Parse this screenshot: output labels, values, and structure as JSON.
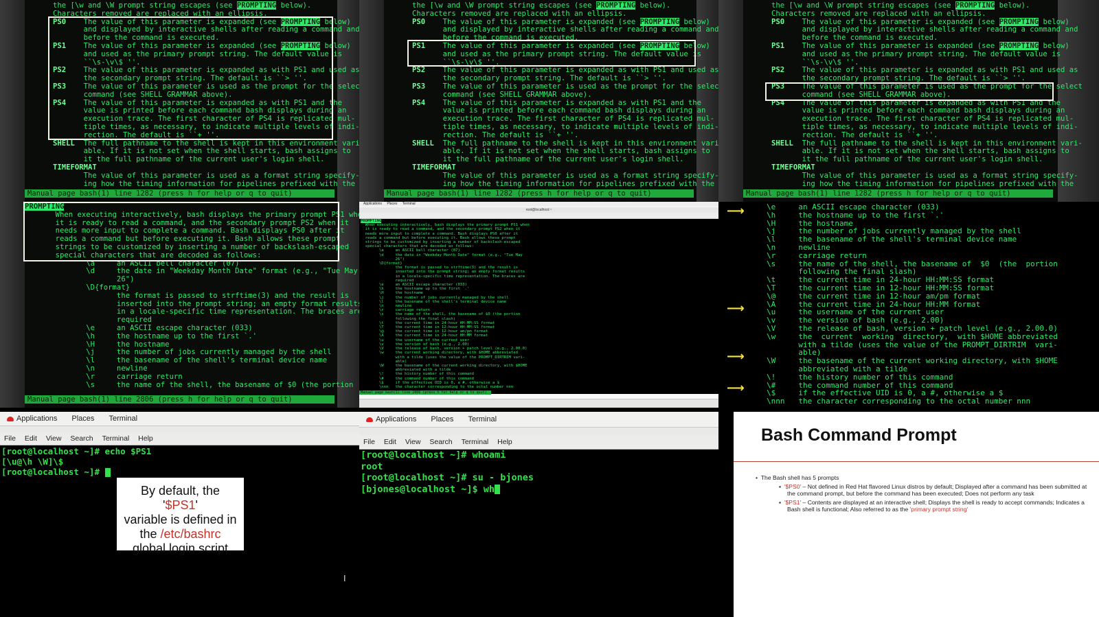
{
  "panel1": {
    "lines": [
      "the [\\w and \\W prompt string escapes (see PROMPTING below).",
      "Characters removed are replaced with an ellipsis.",
      "PS0    The value of this parameter is expanded (see PROMPTING below)",
      "       and displayed by interactive shells after reading a command and",
      "       before the command is executed.",
      "PS1    The value of this parameter is expanded (see PROMPTING below)",
      "       and used as the primary prompt string. The default value is",
      "       ``\\s-\\v\\$ ''.",
      "PS2    The value of this parameter is expanded as with PS1 and used as",
      "       the secondary prompt string. The default is ``> ''.",
      "PS3    The value of this parameter is used as the prompt for the select",
      "       command (see SHELL GRAMMAR above).",
      "PS4    The value of this parameter is expanded as with PS1 and the",
      "       value is printed before each command bash displays during an",
      "       execution trace. The first character of PS4 is replicated mul-",
      "       tiple times, as necessary, to indicate multiple levels of indi-",
      "       rection. The default is ``+ ''.",
      "SHELL  The full pathname to the shell is kept in this environment vari-",
      "       able. If it is not set when the shell starts, bash assigns to",
      "       it the full pathname of the current user's login shell.",
      "TIMEFORMAT",
      "       The value of this parameter is used as a format string specify-",
      "       ing how the timing information for pipelines prefixed with the"
    ],
    "status": "Manual page bash(1) line 1282 (press h for help or q to quit)"
  },
  "panel4": {
    "lines": [
      "PROMPTING",
      "       When executing interactively, bash displays the primary prompt PS1 when",
      "       it is ready to read a command, and the secondary prompt PS2 when it",
      "       needs more input to complete a command. Bash displays PS0 after it",
      "       reads a command but before executing it. Bash allows these prompt",
      "       strings to be customized by inserting a number of backslash-escaped",
      "       special characters that are decoded as follows:",
      "              \\a     an ASCII bell character (07)",
      "              \\d     the date in \"Weekday Month Date\" format (e.g., \"Tue May",
      "                     26\")",
      "              \\D{format}",
      "                     the format is passed to strftime(3) and the result is",
      "                     inserted into the prompt string; an empty format results",
      "                     in a locale-specific time representation. The braces are",
      "                     required",
      "              \\e     an ASCII escape character (033)",
      "              \\h     the hostname up to the first `.'",
      "              \\H     the hostname",
      "              \\j     the number of jobs currently managed by the shell",
      "              \\l     the basename of the shell's terminal device name",
      "              \\n     newline",
      "              \\r     carriage return",
      "              \\s     the name of the shell, the basename of $0 (the portion"
    ],
    "status": "Manual page bash(1) line 2806 (press h for help or q to quit)"
  },
  "panel5": {
    "topbar": [
      "Applications",
      "Places",
      "Terminal"
    ],
    "window_title": "root@localhost:~",
    "lines": [
      "PROMPTING",
      "  When executing interactively, bash displays the primary prompt PS1 when",
      "  it is ready to read a command, and the secondary prompt PS2 when it",
      "  needs more input to complete a command. Bash displays PS0 after it",
      "  reads a command but before executing it. Bash allows these prompt",
      "  strings to be customized by inserting a number of backslash-escaped",
      "  special characters that are decoded as follows:",
      "        \\a     an ASCII bell character (07)",
      "        \\d     the date in \"Weekday Month Date\" format (e.g., \"Tue May",
      "               26\")",
      "        \\D{format}",
      "               the format is passed to strftime(3) and the result is",
      "               inserted into the prompt string; an empty format results",
      "               in a locale-specific time representation. The braces are",
      "               required",
      "        \\e     an ASCII escape character (033)",
      "        \\h     the hostname up to the first `.'",
      "        \\H     the hostname",
      "        \\j     the number of jobs currently managed by the shell",
      "        \\l     the basename of the shell's terminal device name",
      "        \\n     newline",
      "        \\r     carriage return",
      "        \\s     the name of the shell, the basename of $0 (the portion",
      "               following the final slash)",
      "        \\t     the current time in 24-hour HH:MM:SS format",
      "        \\T     the current time in 12-hour HH:MM:SS format",
      "        \\@     the current time in 12-hour am/pm format",
      "        \\A     the current time in 24-hour HH:MM format",
      "        \\u     the username of the current user",
      "        \\v     the version of bash (e.g., 2.00)",
      "        \\V     the release of bash, version + patch level (e.g., 2.00.0)",
      "        \\w     the current working directory, with $HOME abbreviated",
      "               with a tilde (uses the value of the PROMPT_DIRTRIM vari-",
      "               able)",
      "        \\W     the basename of the current working directory, with $HOME",
      "               abbreviated with a tilde",
      "        \\!     the history number of this command",
      "        \\#     the command number of this command",
      "        \\$     if the effective UID is 0, a #, otherwise a $",
      "        \\nnn   the character corresponding to the octal number nnn"
    ],
    "status": "Manual page bash(1) line 2806 (press h for help or q to quit)"
  },
  "panel6": {
    "lines": [
      "\\e     an ASCII escape character (033)",
      "\\h     the hostname up to the first `.'",
      "\\H     the hostname",
      "\\j     the number of jobs currently managed by the shell",
      "\\l     the basename of the shell's terminal device name",
      "\\n     newline",
      "\\r     carriage return",
      "\\s     the name of the shell, the basename of  $0  (the  portion",
      "       following the final slash)",
      "\\t     the current time in 24-hour HH:MM:SS format",
      "\\T     the current time in 12-hour HH:MM:SS format",
      "\\@     the current time in 12-hour am/pm format",
      "\\A     the current time in 24-hour HH:MM format",
      "\\u     the username of the current user",
      "\\v     the version of bash (e.g., 2.00)",
      "\\V     the release of bash, version + patch level (e.g., 2.00.0)",
      "\\w     the  current  working  directory,  with $HOME abbreviated",
      "       with a tilde (uses the value of the PROMPT_DIRTRIM  vari-",
      "       able)",
      "\\W     the basename of the current working directory, with $HOME",
      "       abbreviated with a tilde",
      "\\!     the history number of this command",
      "\\#     the command number of this command",
      "\\$     if the effective UID is 0, a #, otherwise a $",
      "\\nnn   the character corresponding to the octal number nnn"
    ],
    "arrow_glyph": "⟶"
  },
  "panel7": {
    "topbar": [
      "Applications",
      "Places",
      "Terminal"
    ],
    "menu": [
      "File",
      "Edit",
      "View",
      "Search",
      "Terminal",
      "Help"
    ],
    "lines": [
      "[root@localhost ~]# echo $PS1",
      "[\\u@\\h \\W]\\$",
      "[root@localhost ~]# "
    ],
    "callout": {
      "line1_pre": "By default, the '",
      "line1_var": "$PS1",
      "line1_post": "'",
      "line2": "variable is defined in",
      "line3_pre": "the ",
      "line3_path": "/etc/bashrc",
      "line4": "global login script"
    }
  },
  "panel8": {
    "topbar": [
      "Applications",
      "Places",
      "Terminal"
    ],
    "menu": [
      "File",
      "Edit",
      "View",
      "Search",
      "Terminal",
      "Help"
    ],
    "lines": [
      "[root@localhost ~]# whoami",
      "root",
      "[root@localhost ~]# su - bjones",
      "[bjones@localhost ~]$ wh"
    ]
  },
  "slide": {
    "title": "Bash Command Prompt",
    "bullet": "The Bash shell has 5 prompts",
    "sub": [
      {
        "quoted": "'$PS0'",
        "text": " – Not defined in Red Hat flavored Linux distros by default; Displayed after a command has been submitted at the command prompt, but before the command has been executed; Does not perform any task"
      },
      {
        "quoted": "'$PS1'",
        "text": " – Contents are displayed at an interactive shell; Displays the shell is ready to accept commands; Indicates a Bash shell is functional; Also referred to as the ",
        "tail": "'primary prompt string'"
      }
    ]
  },
  "colors": {
    "terminal_green": "#2ee86a",
    "highlight_box": "#f6f6e8",
    "arrow": "#f5e23c",
    "accent_red": "#c43328"
  }
}
